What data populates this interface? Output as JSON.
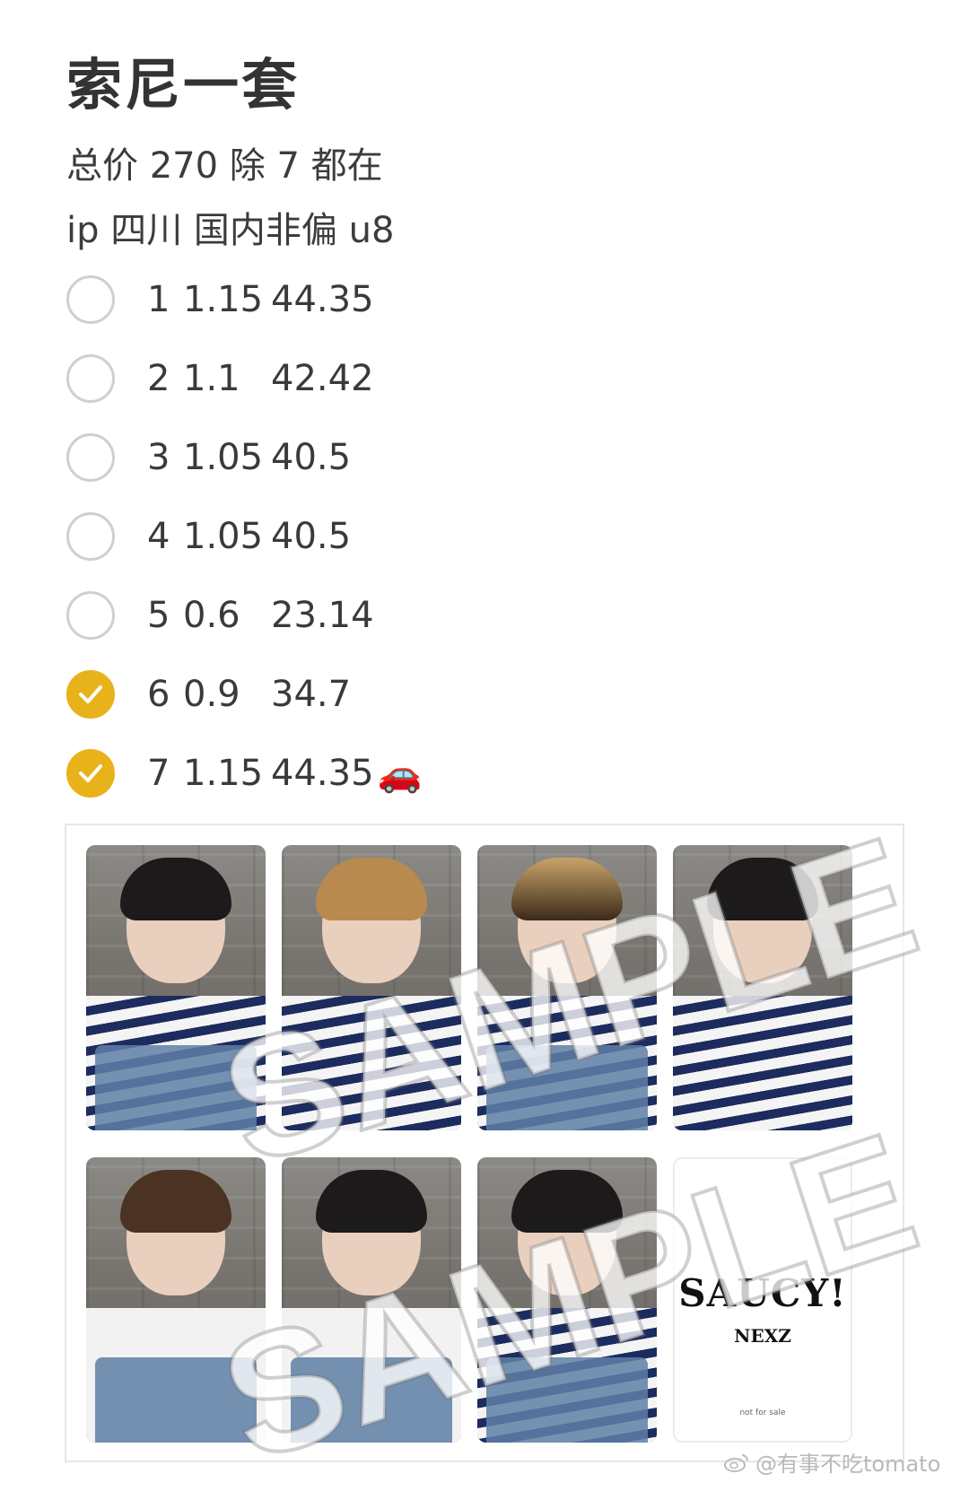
{
  "post": {
    "title": "索尼一套",
    "line1": "总价 270 除 7 都在",
    "line2": "ip 四川  国内非偏 u8"
  },
  "checklist": [
    {
      "num": "1",
      "a": "1.15",
      "b": "44.35",
      "checked": false
    },
    {
      "num": "2",
      "a": "1.1",
      "b": "42.42",
      "checked": false
    },
    {
      "num": "3",
      "a": "1.05",
      "b": "40.5",
      "checked": false
    },
    {
      "num": "4",
      "a": "1.05",
      "b": "40.5",
      "checked": false
    },
    {
      "num": "5",
      "a": "0.6",
      "b": "23.14",
      "checked": false
    },
    {
      "num": "6",
      "a": "0.9",
      "b": "34.7",
      "checked": true
    },
    {
      "num": "7",
      "a": "1.15",
      "b": "44.35",
      "checked": true,
      "emoji": "🚗"
    }
  ],
  "colors": {
    "check_accent": "#e8b21a",
    "circle_border": "#cfcfcf"
  },
  "photo_sheet": {
    "watermark_text": "SAMPLE",
    "logo_card": {
      "mark": "SAUCY!",
      "sub": "NEXZ",
      "foot": "not for sale"
    }
  },
  "watermark": {
    "icon": "weibo-icon",
    "text": "@有事不吃tomato"
  }
}
